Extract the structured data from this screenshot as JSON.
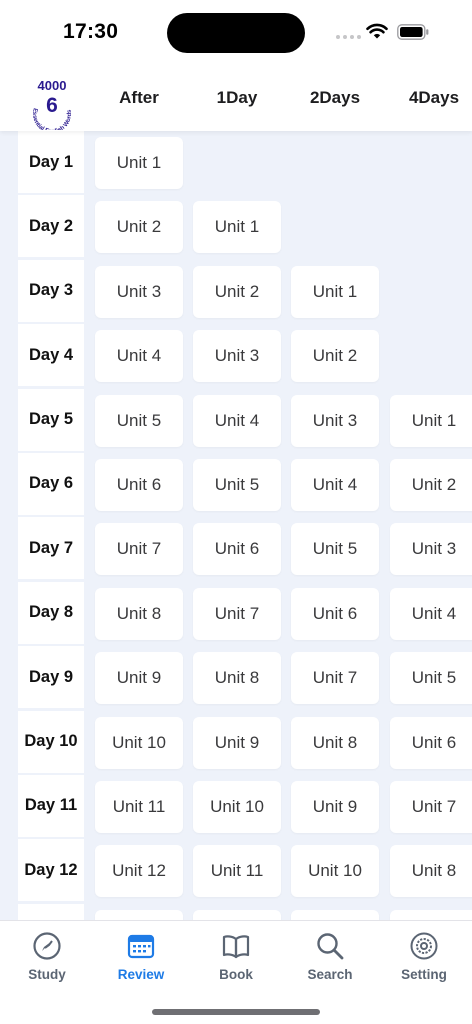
{
  "status": {
    "time": "17:30"
  },
  "logo": {
    "top_text": "4000",
    "number": "6",
    "ring_text": "Essential English Words"
  },
  "columns": [
    "After",
    "1Day",
    "2Days",
    "4Days"
  ],
  "rows": [
    {
      "day": "Day 1",
      "units": [
        "Unit 1",
        "",
        "",
        ""
      ]
    },
    {
      "day": "Day 2",
      "units": [
        "Unit 2",
        "Unit 1",
        "",
        ""
      ]
    },
    {
      "day": "Day 3",
      "units": [
        "Unit 3",
        "Unit 2",
        "Unit 1",
        ""
      ]
    },
    {
      "day": "Day 4",
      "units": [
        "Unit 4",
        "Unit 3",
        "Unit 2",
        ""
      ]
    },
    {
      "day": "Day 5",
      "units": [
        "Unit 5",
        "Unit 4",
        "Unit 3",
        "Unit 1"
      ]
    },
    {
      "day": "Day 6",
      "units": [
        "Unit 6",
        "Unit 5",
        "Unit 4",
        "Unit 2"
      ]
    },
    {
      "day": "Day 7",
      "units": [
        "Unit 7",
        "Unit 6",
        "Unit 5",
        "Unit 3"
      ]
    },
    {
      "day": "Day 8",
      "units": [
        "Unit 8",
        "Unit 7",
        "Unit 6",
        "Unit 4"
      ]
    },
    {
      "day": "Day 9",
      "units": [
        "Unit 9",
        "Unit 8",
        "Unit 7",
        "Unit 5"
      ]
    },
    {
      "day": "Day 10",
      "units": [
        "Unit 10",
        "Unit 9",
        "Unit 8",
        "Unit 6"
      ]
    },
    {
      "day": "Day 11",
      "units": [
        "Unit 11",
        "Unit 10",
        "Unit 9",
        "Unit 7"
      ]
    },
    {
      "day": "Day 12",
      "units": [
        "Unit 12",
        "Unit 11",
        "Unit 10",
        "Unit 8"
      ]
    }
  ],
  "tabs": [
    {
      "label": "Study",
      "icon": "compass-icon",
      "active": false
    },
    {
      "label": "Review",
      "icon": "calendar-icon",
      "active": true
    },
    {
      "label": "Book",
      "icon": "book-icon",
      "active": false
    },
    {
      "label": "Search",
      "icon": "search-icon",
      "active": false
    },
    {
      "label": "Setting",
      "icon": "gear-icon",
      "active": false
    }
  ],
  "colors": {
    "accent": "#1e7be6",
    "logo": "#2a1a8f",
    "background": "#eef2fa"
  }
}
